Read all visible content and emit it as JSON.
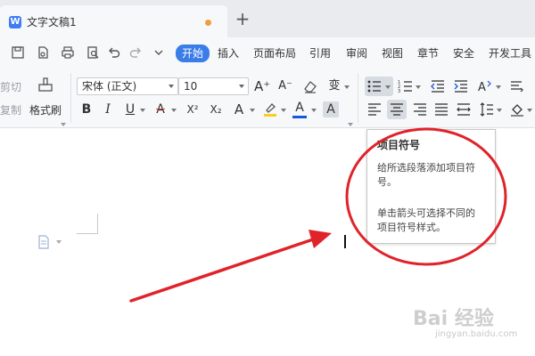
{
  "tab": {
    "title": "文字文稿1",
    "icon": "W",
    "new_tab": "+"
  },
  "menu": {
    "tabs": [
      "开始",
      "插入",
      "页面布局",
      "引用",
      "审阅",
      "视图",
      "章节",
      "安全",
      "开发工具"
    ]
  },
  "ribbon": {
    "cut_label": "剪切",
    "copy_label": "复制",
    "format_painter_label": "格式刷",
    "font_family": "宋体 (正文)",
    "font_size": "10",
    "bold": "B",
    "italic": "I",
    "underline": "U",
    "strikethrough": "A",
    "superscript": "X²",
    "subscript": "X₂",
    "text_effect": "A",
    "font_color": "A",
    "char_shading": "A",
    "grow_font": "A⁺",
    "shrink_font": "A⁻",
    "phonetic": "变",
    "colors": {
      "font_color": "#1a56db",
      "highlight": "#f5d020",
      "strike": "#e0322d"
    }
  },
  "tooltip": {
    "title": "项目符号",
    "line1": "给所选段落添加项目符",
    "line2": "号。",
    "line3": "单击箭头可选择不同的",
    "line4": "项目符号样式。"
  },
  "watermark": {
    "text": "Bai 经验",
    "sub": "jingyan.baidu.com"
  },
  "colors": {
    "accent": "#3b7de8",
    "annotation": "#e0232a"
  }
}
